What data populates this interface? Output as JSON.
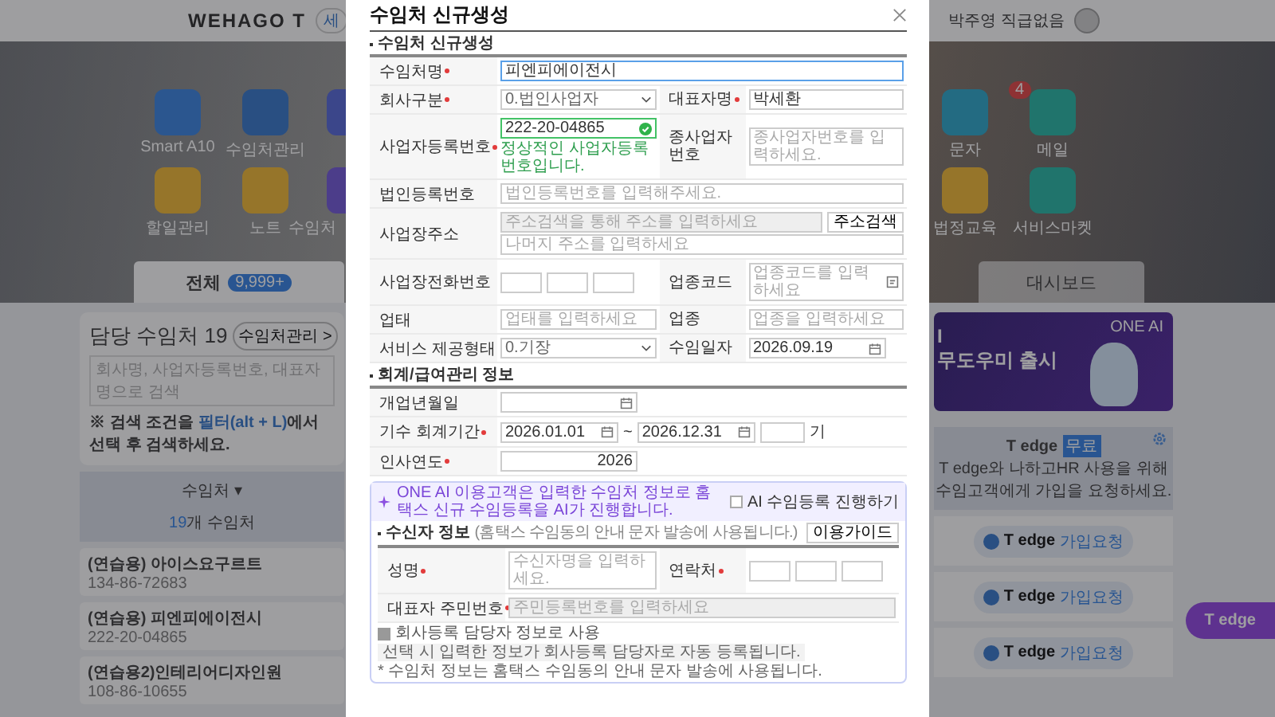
{
  "topbar": {
    "logo": "WEHAGO T",
    "chip": "세",
    "user": "박주영 직급없음"
  },
  "apps": {
    "left_rows": [
      [
        {
          "label": "Smart A10"
        },
        {
          "label": "수임처관리"
        }
      ],
      [
        {
          "label": "할일관리"
        },
        {
          "label": "노트"
        },
        {
          "label": "수임처"
        }
      ]
    ],
    "right_rows": [
      [
        {
          "label": "문자"
        },
        {
          "label": "메일",
          "badge": "4"
        }
      ],
      [
        {
          "label": "법정교육"
        },
        {
          "label": "서비스마켓"
        }
      ]
    ]
  },
  "tabs": [
    {
      "label": "전체",
      "badge": "9,999+",
      "selected": true
    },
    {
      "label": "대시보드",
      "selected": false
    }
  ],
  "clients": {
    "title": "담당 수임처 19",
    "manage_button": "수임처관리 >",
    "search_placeholder": "회사명, 사업자등록번호, 대표자명으로 검색",
    "tip_before": "※ 검색 조건을 ",
    "tip_link": "필터(alt + L)",
    "tip_after": "에서 선택 후 검색하세요.",
    "column": "수임처 ▾",
    "count": "19",
    "count_suffix": "개 수임처",
    "rows": [
      {
        "name": "(연습용) 아이스요구르트",
        "number": "134-86-72683"
      },
      {
        "name": "(연습용) 피엔피에이전시",
        "number": "222-20-04865"
      },
      {
        "name": "(연습용2)인테리어디자인원",
        "number": "108-86-10655"
      }
    ]
  },
  "banner": {
    "lines": [
      "I",
      "무도우미 출시"
    ],
    "logo": "ONE AI"
  },
  "tedge": {
    "brand": "T edge",
    "badge": "무료",
    "message": [
      "T edge와 나하고HR 사용을 위해",
      "수임고객에게 가입을 요청하세요."
    ],
    "requests": [
      {
        "brand": "T edge",
        "label": "가입요청"
      },
      {
        "brand": "T edge",
        "label": "가입요청"
      },
      {
        "brand": "T edge",
        "label": "가입요청"
      }
    ],
    "floating": "T edge"
  },
  "modal": {
    "title": "수임처 신규생성",
    "sections": [
      {
        "heading": "수임처 신규생성",
        "rows": [
          {
            "cells": [
              {
                "label": "수임처명",
                "required": true,
                "field": {
                  "kind": "text",
                  "value": "피엔피에이전시",
                  "focused": true
                }
              }
            ]
          },
          {
            "cells": [
              {
                "label": "회사구분",
                "required": true,
                "field": {
                  "kind": "select",
                  "value": "0.법인사업자"
                }
              },
              {
                "label": "대표자명",
                "required": true,
                "field": {
                  "kind": "text",
                  "value": "박세환",
                  "focused": false
                }
              }
            ]
          },
          {
            "cells": [
              {
                "label": "사업자등록번호",
                "required": true,
                "field": {
                  "kind": "verified",
                  "value": "222-20-04865",
                  "message": "정상적인 사업자등록번호입니다."
                }
              },
              {
                "label": "종사업자번호",
                "required": false,
                "field": {
                  "kind": "text",
                  "placeholder": "종사업자번호를 입력하세요.",
                  "focused": false
                }
              }
            ]
          },
          {
            "cells": [
              {
                "label": "법인등록번호",
                "required": false,
                "field": {
                  "kind": "text",
                  "placeholder": "법인등록번호를 입력해주세요.",
                  "focused": false
                }
              }
            ]
          },
          {
            "cells": [
              {
                "label": "사업장주소",
                "required": false,
                "field": {
                  "kind": "address",
                  "placeholder": "주소검색을 통해 주소를 입력하세요",
                  "button": "주소검색",
                  "detail_placeholder": "나머지 주소를 입력하세요"
                }
              }
            ]
          },
          {
            "cells": [
              {
                "label": "사업장전화번호",
                "required": false,
                "field": {
                  "kind": "phone"
                }
              },
              {
                "label": "업종코드",
                "required": false,
                "field": {
                  "kind": "code",
                  "placeholder": "업종코드를 입력하세요"
                }
              }
            ]
          },
          {
            "cells": [
              {
                "label": "업태",
                "required": false,
                "field": {
                  "kind": "text",
                  "placeholder": "업태를 입력하세요",
                  "focused": false
                }
              },
              {
                "label": "업종",
                "required": false,
                "field": {
                  "kind": "text",
                  "placeholder": "업종을 입력하세요",
                  "focused": false
                }
              }
            ]
          },
          {
            "cells": [
              {
                "label": "서비스 제공형태",
                "required": false,
                "field": {
                  "kind": "select",
                  "value": "0.기장"
                }
              },
              {
                "label": "수임일자",
                "required": false,
                "field": {
                  "kind": "date",
                  "value": "2026.09.19"
                }
              }
            ]
          }
        ]
      },
      {
        "heading": "회계/급여관리 정보",
        "rows": [
          {
            "cells": [
              {
                "label": "개업년월일",
                "required": false,
                "field": {
                  "kind": "date"
                }
              }
            ]
          },
          {
            "cells": [
              {
                "label": "기수 회계기간",
                "required": true,
                "field": {
                  "kind": "period",
                  "from": "2026.01.01",
                  "separator": "~",
                  "to": "2026.12.31",
                  "suffix": "기"
                }
              }
            ]
          },
          {
            "cells": [
              {
                "label": "인사연도",
                "required": true,
                "field": {
                  "kind": "number",
                  "value": "2026"
                }
              }
            ]
          }
        ]
      }
    ],
    "ai": {
      "notice": "ONE AI 이용고객은 입력한 수임처 정보로 홈택스 신규 수임등록을 AI가 진행합니다.",
      "checkbox": {
        "label": "AI 수임등록 진행하기",
        "checked": false
      },
      "receiver": {
        "heading": "수신자 정보",
        "hint": "(홈택스 수임동의 안내 문자 발송에 사용됩니다.)",
        "guide_button": "이용가이드",
        "rows": [
          {
            "cells": [
              {
                "label": "성명",
                "required": true,
                "field": {
                  "kind": "text",
                  "placeholder": "수신자명을 입력하세요.",
                  "focused": false
                }
              },
              {
                "label": "연락처",
                "required": true,
                "field": {
                  "kind": "phone"
                }
              }
            ]
          },
          {
            "cells": [
              {
                "label": "대표자 주민번호",
                "required": true,
                "field": {
                  "kind": "locked",
                  "placeholder": "주민등록번호를 입력하세요"
                }
              }
            ]
          }
        ]
      },
      "use_company": {
        "label": "회사등록 담당자 정보로 사용",
        "checked": true,
        "hint": "선택 시 입력한 정보가 회사등록 담당자로 자동 등록됩니다."
      },
      "notes": [
        "* 수임처 정보는 홈택스 수임동의 안내 문자 발송에 사용됩니다."
      ]
    }
  }
}
